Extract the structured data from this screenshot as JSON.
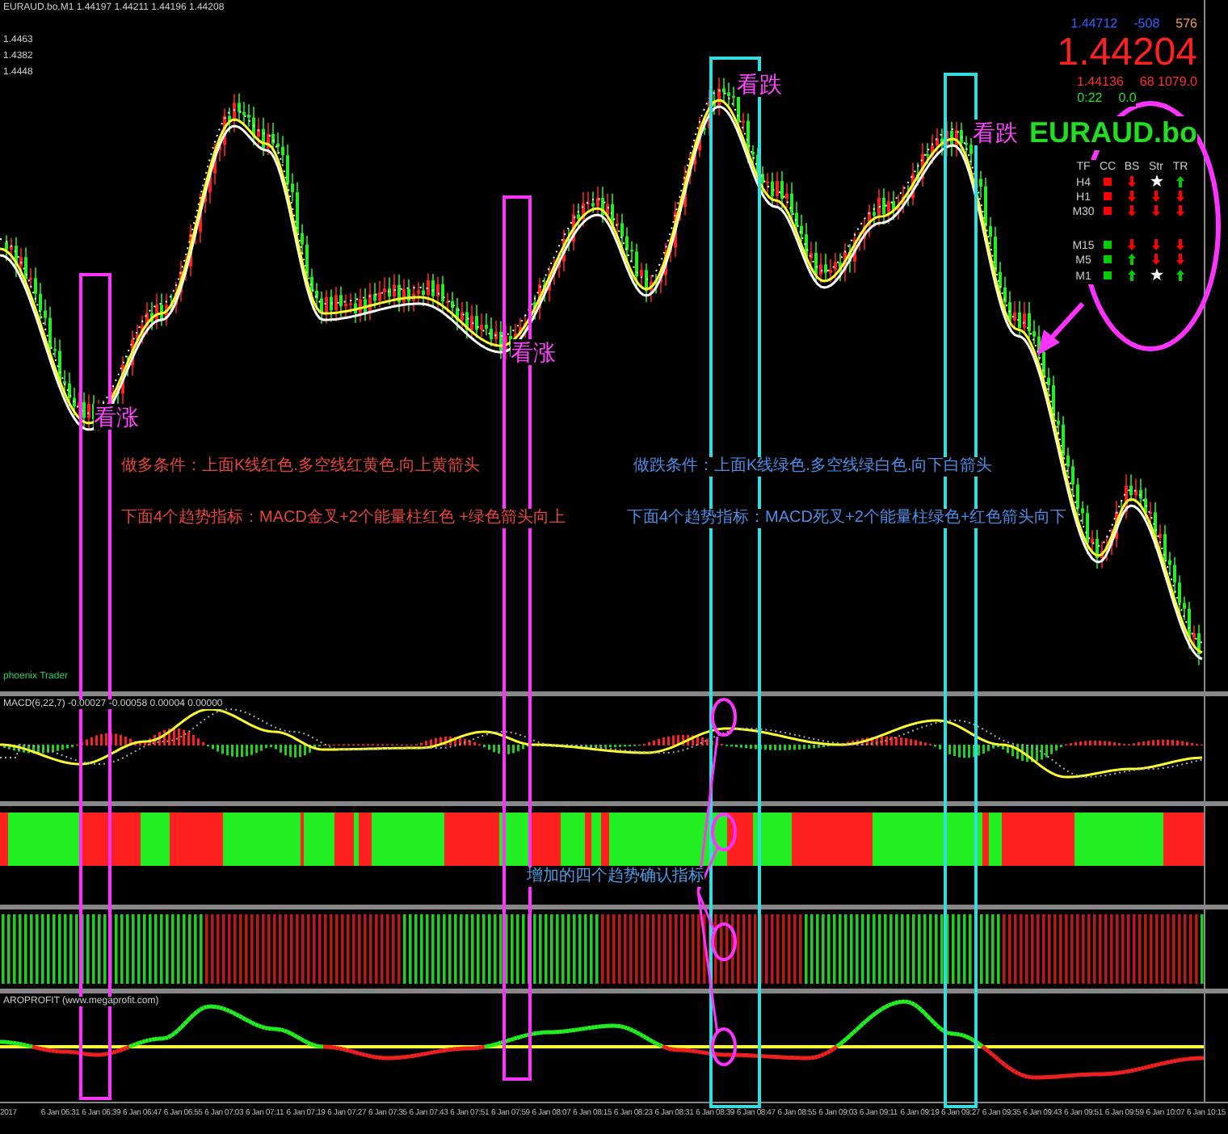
{
  "header": {
    "symbol_line": "EURAUD.bo,M1 1.44197 1.44211 1.44196 1.44208",
    "levels": [
      "1.4463",
      "1.4382",
      "1.4448"
    ]
  },
  "info_panel": {
    "top_row": [
      "1.44712",
      "-508",
      "576"
    ],
    "price": "1.44204",
    "second_row": [
      "1.44136",
      "68 1079.0"
    ],
    "third_row": [
      "0:22",
      "0.0"
    ],
    "symbol": "EURAUD.bo",
    "columns": [
      "TF",
      "CC",
      "BS",
      "Str",
      "TR"
    ],
    "groups": [
      [
        {
          "tf": "H4",
          "cells": [
            {
              "kind": "square",
              "color": "#ff0000"
            },
            {
              "kind": "down",
              "color": "#ff0000"
            },
            {
              "kind": "star",
              "color": "#ffffff"
            },
            {
              "kind": "up",
              "color": "#00cc00"
            }
          ]
        },
        {
          "tf": "H1",
          "cells": [
            {
              "kind": "square",
              "color": "#ff0000"
            },
            {
              "kind": "down",
              "color": "#ff0000"
            },
            {
              "kind": "down",
              "color": "#ff0000"
            },
            {
              "kind": "down",
              "color": "#ff0000"
            }
          ]
        },
        {
          "tf": "M30",
          "cells": [
            {
              "kind": "square",
              "color": "#ff0000"
            },
            {
              "kind": "down",
              "color": "#ff0000"
            },
            {
              "kind": "down",
              "color": "#ff0000"
            },
            {
              "kind": "down",
              "color": "#ff0000"
            }
          ]
        }
      ],
      [
        {
          "tf": "M15",
          "cells": [
            {
              "kind": "square",
              "color": "#00cc00"
            },
            {
              "kind": "down",
              "color": "#ff0000"
            },
            {
              "kind": "down",
              "color": "#ff0000"
            },
            {
              "kind": "down",
              "color": "#ff0000"
            }
          ]
        },
        {
          "tf": "M5",
          "cells": [
            {
              "kind": "square",
              "color": "#00cc00"
            },
            {
              "kind": "up",
              "color": "#00cc00"
            },
            {
              "kind": "down",
              "color": "#ff0000"
            },
            {
              "kind": "down",
              "color": "#ff0000"
            }
          ]
        },
        {
          "tf": "M1",
          "cells": [
            {
              "kind": "square",
              "color": "#00cc00"
            },
            {
              "kind": "up",
              "color": "#00cc00"
            },
            {
              "kind": "star",
              "color": "#ffffff"
            },
            {
              "kind": "up",
              "color": "#00cc00"
            }
          ]
        }
      ]
    ]
  },
  "annotations": [
    {
      "text": "看涨",
      "color": "#ff44ff"
    },
    {
      "text": "看涨",
      "color": "#ff44ff"
    },
    {
      "text": "看跌",
      "color": "#ff44ff"
    },
    {
      "text": "看跌",
      "color": "#ff44ff"
    },
    {
      "text": "做多条件：上面K线红色.多空线红黄色.向上黄箭头",
      "color": "#e8453a"
    },
    {
      "text": "下面4个趋势指标：MACD金叉+2个能量柱红色 +绿色箭头向上",
      "color": "#e8453a"
    },
    {
      "text": "做跌条件：上面K线绿色.多空线绿白色.向下白箭头",
      "color": "#4a8ee8"
    },
    {
      "text": "下面4个趋势指标：MACD死叉+2个能量柱绿色+红色箭头向下",
      "color": "#4a8ee8"
    },
    {
      "text": "增加的四个趋势确认指标",
      "color": "#4a9ee8"
    }
  ],
  "brand": "phoenix Trader",
  "indicators": [
    {
      "label": "MACD(6,22,7) -0.00027 -0.00058 0.00004 0.00000"
    },
    {
      "label": "AROPROFIT (www.megaprofit.com)"
    }
  ],
  "highlights": [
    {
      "color": "#ff33ff"
    },
    {
      "color": "#ff33ff"
    },
    {
      "color": "#33dddd"
    },
    {
      "color": "#33dddd"
    }
  ],
  "time_axis": [
    "2017",
    "6 Jan 06:31",
    "6 Jan 06:39",
    "6 Jan 06:47",
    "6 Jan 06:55",
    "6 Jan 07:03",
    "6 Jan 07:11",
    "6 Jan 07:19",
    "6 Jan 07:27",
    "6 Jan 07:35",
    "6 Jan 07:43",
    "6 Jan 07:51",
    "6 Jan 07:59",
    "6 Jan 08:07",
    "6 Jan 08:15",
    "6 Jan 08:23",
    "6 Jan 08:31",
    "6 Jan 08:39",
    "6 Jan 08:47",
    "6 Jan 08:55",
    "6 Jan 09:03",
    "6 Jan 09:11",
    "6 Jan 09:19",
    "6 Jan 09:27",
    "6 Jan 09:35",
    "6 Jan 09:43",
    "6 Jan 09:51",
    "6 Jan 09:59",
    "6 Jan 10:07",
    "6 Jan 10:15"
  ]
}
